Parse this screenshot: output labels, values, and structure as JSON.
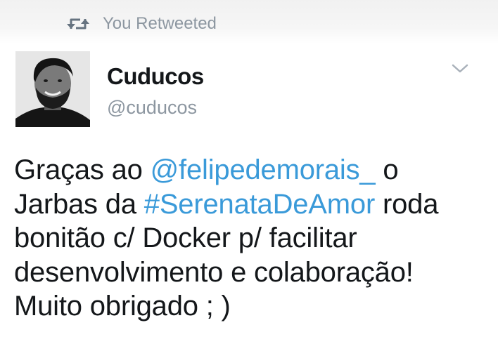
{
  "retweet_banner": {
    "icon": "retweet-icon",
    "label": "You Retweeted"
  },
  "author": {
    "display_name": "Cuducos",
    "handle": "@cuducos",
    "avatar_icon": "profile-photo"
  },
  "menu": {
    "icon": "chevron-down-icon"
  },
  "tweet": {
    "part1": "Graças ao ",
    "mention": "@felipedemorais_",
    "part2": " o Jarbas da ",
    "hashtag": "#SerenataDeAmor",
    "part3": " roda bonitão c/ Docker p/ facilitar desenvolvimento e colaboração! Muito obrigado ; )"
  },
  "colors": {
    "link": "#3a9ad9",
    "text": "#14171a",
    "secondary": "#8c96a0"
  }
}
